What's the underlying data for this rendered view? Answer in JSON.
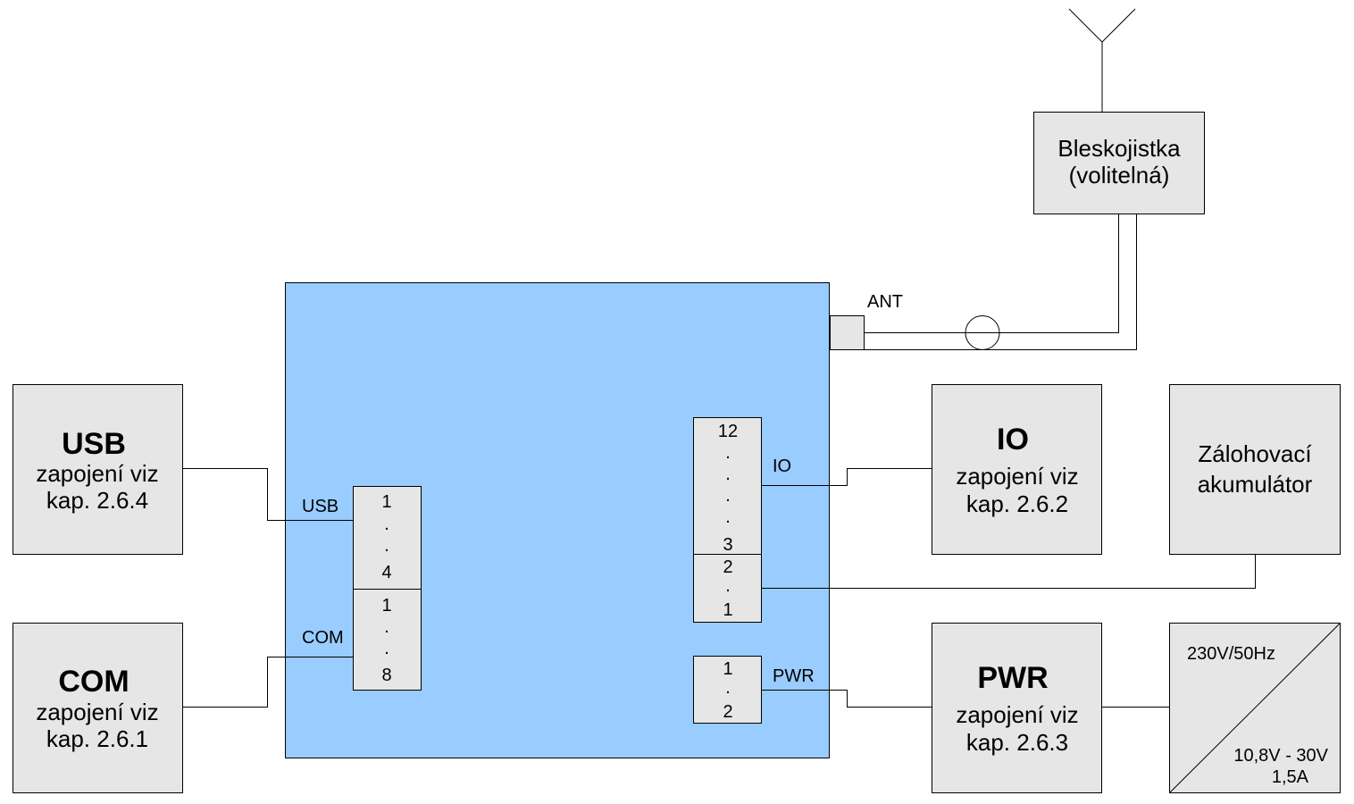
{
  "colors": {
    "board": "#99ccff",
    "box": "#e6e6e6",
    "line": "#000000"
  },
  "surge_protector": {
    "line1": "Bleskojistka",
    "line2": "(volitelná)"
  },
  "antenna": {
    "label": "ANT"
  },
  "usb": {
    "title": "USB",
    "line1": "zapojení viz",
    "line2": "kap. 2.6.4",
    "port_label": "USB",
    "pins": [
      "1",
      ".",
      ".",
      "4"
    ]
  },
  "com": {
    "title": "COM",
    "line1": "zapojení viz",
    "line2": "kap. 2.6.1",
    "port_label": "COM",
    "pins": [
      "1",
      ".",
      ".",
      "8"
    ]
  },
  "io": {
    "title": "IO",
    "line1": "zapojení viz",
    "line2": "kap. 2.6.2",
    "port_label": "IO",
    "pins": [
      "12",
      ".",
      ".",
      ".",
      ".",
      "3"
    ]
  },
  "battery": {
    "line1": "Zálohovací",
    "line2": "akumulátor",
    "pins": [
      "2",
      ".",
      "1"
    ]
  },
  "pwr": {
    "title": "PWR",
    "line1": "zapojení viz",
    "line2": "kap. 2.6.3",
    "port_label": "PWR",
    "pins": [
      "1",
      ".",
      "2"
    ]
  },
  "supply": {
    "input": "230V/50Hz",
    "output1": "10,8V - 30V",
    "output2": "1,5A"
  }
}
